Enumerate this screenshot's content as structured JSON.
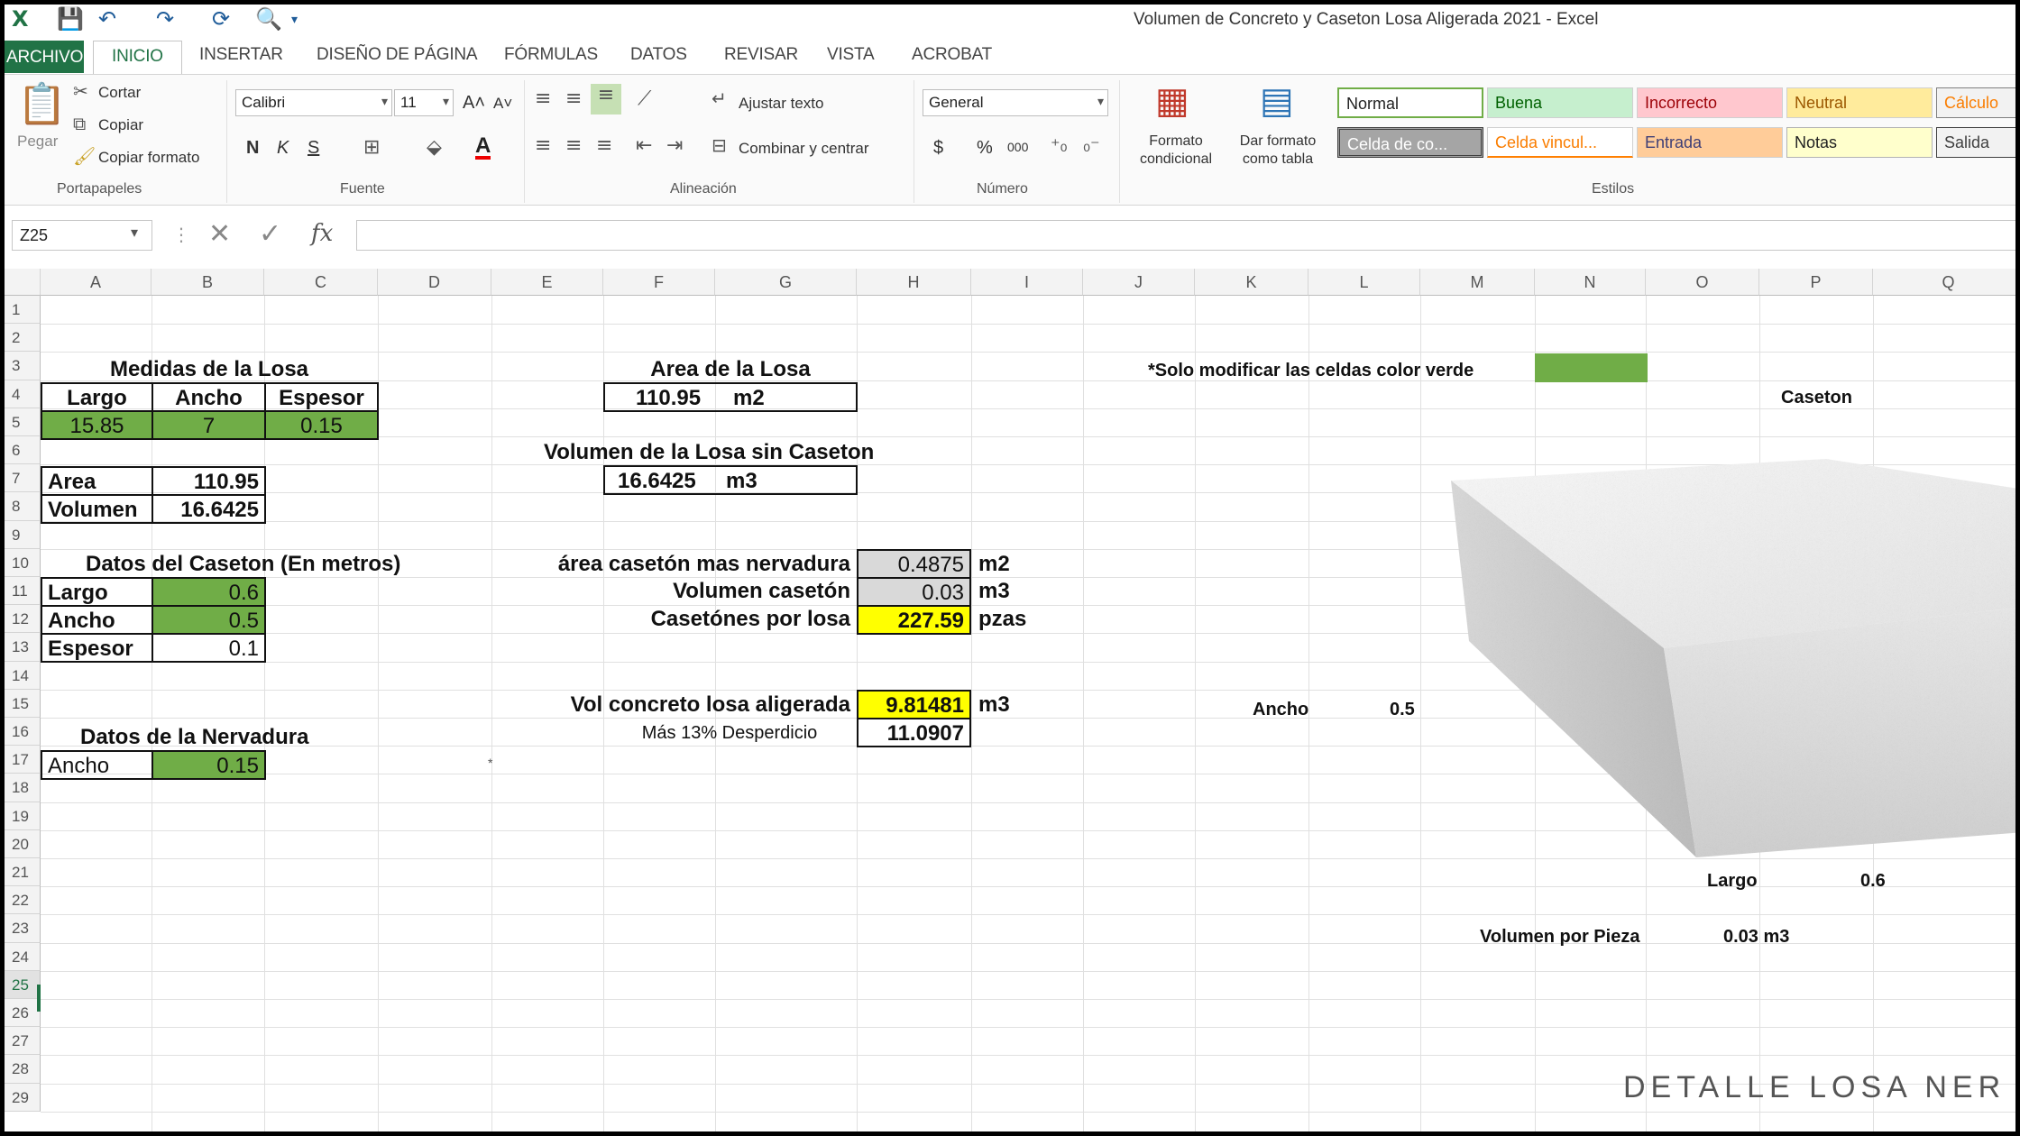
{
  "window": {
    "title": "Volumen de Concreto y Caseton Losa Aligerada 2021 - Excel"
  },
  "tabs": [
    "ARCHIVO",
    "INICIO",
    "INSERTAR",
    "DISEÑO DE PÁGINA",
    "FÓRMULAS",
    "DATOS",
    "REVISAR",
    "VISTA",
    "ACROBAT"
  ],
  "ribbon": {
    "clipboard": {
      "paste": "Pegar",
      "cut": "Cortar",
      "copy": "Copiar",
      "format_painter": "Copiar formato",
      "group": "Portapapeles"
    },
    "font": {
      "name": "Calibri",
      "size": "11",
      "bold": "N",
      "italic": "K",
      "underline": "S",
      "color_letter": "A",
      "group": "Fuente"
    },
    "alignment": {
      "wrap": "Ajustar texto",
      "merge": "Combinar y centrar",
      "group": "Alineación"
    },
    "number": {
      "format": "General",
      "currency": "$",
      "percent": "%",
      "thousands": "000",
      "group": "Número"
    },
    "styles": {
      "conditional": "Formato condicional",
      "as_table": "Dar formato como tabla",
      "group": "Estilos",
      "items": [
        "Normal",
        "Buena",
        "Incorrecto",
        "Neutral",
        "Cálculo",
        "Celda de co...",
        "Celda vincul...",
        "Entrada",
        "Notas",
        "Salida"
      ]
    }
  },
  "formula_bar": {
    "name_box": "Z25",
    "fx": "fx"
  },
  "columns": [
    "A",
    "B",
    "C",
    "D",
    "E",
    "F",
    "G",
    "H",
    "I",
    "J",
    "K",
    "L",
    "M",
    "N",
    "O",
    "P",
    "Q"
  ],
  "rows": [
    "1",
    "2",
    "3",
    "4",
    "5",
    "6",
    "7",
    "8",
    "9",
    "10",
    "11",
    "12",
    "13",
    "14",
    "15",
    "16",
    "17",
    "18",
    "19",
    "20",
    "21",
    "22",
    "23",
    "24",
    "25",
    "26",
    "27",
    "28",
    "29"
  ],
  "cells": {
    "medidas_title": "Medidas de la Losa",
    "largo_h": "Largo",
    "ancho_h": "Ancho",
    "espesor_h": "Espesor",
    "largo_v": "15.85",
    "ancho_v": "7",
    "espesor_v": "0.15",
    "area_l": "Area",
    "area_v": "110.95",
    "vol_l": "Volumen",
    "vol_v": "16.6425",
    "caseton_title": "Datos del Caseton (En metros)",
    "c_largo_l": "Largo",
    "c_largo_v": "0.6",
    "c_ancho_l": "Ancho",
    "c_ancho_v": "0.5",
    "c_esp_l": "Espesor",
    "c_esp_v": "0.1",
    "nerv_title": "Datos de la Nervadura",
    "n_ancho_l": "Ancho",
    "n_ancho_v": "0.15",
    "area_losa_title": "Area de la Losa",
    "area_losa_v": "110.95",
    "area_losa_u": "m2",
    "vol_sin_title": "Volumen de la Losa sin Caseton",
    "vol_sin_v": "16.6425",
    "vol_sin_u": "m3",
    "area_cas_l": "área casetón mas nervadura",
    "area_cas_v": "0.4875",
    "area_cas_u": "m2",
    "vol_cas_l": "Volumen casetón",
    "vol_cas_v": "0.03",
    "vol_cas_u": "m3",
    "cas_losa_l": "Casetónes por losa",
    "cas_losa_v": "227.59",
    "cas_losa_u": "pzas",
    "vol_conc_l": "Vol concreto losa aligerada",
    "vol_conc_v": "9.81481",
    "vol_conc_u": "m3",
    "desp_l": "Más 13% Desperdicio",
    "desp_v": "11.0907",
    "note": "*Solo modificar las celdas color verde",
    "caseton_lbl": "Caseton",
    "img_ancho_l": "Ancho",
    "img_ancho_v": "0.5",
    "img_largo_l": "Largo",
    "img_largo_v": "0.6",
    "vol_pieza_l": "Volumen por Pieza",
    "vol_pieza_v": "0.03 m3"
  },
  "overlay": {
    "detalle": "DETALLE LOSA NER"
  }
}
